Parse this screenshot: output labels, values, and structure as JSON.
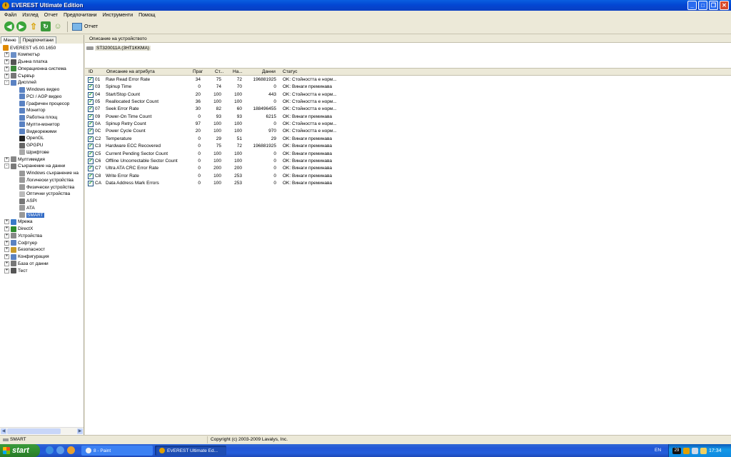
{
  "window": {
    "title": "EVEREST Ultimate Edition"
  },
  "menu": [
    "Файл",
    "Изглед",
    "Отчет",
    "Предпочитани",
    "Инструменти",
    "Помощ"
  ],
  "toolbar": {
    "report_label": "Отчет"
  },
  "left_tabs": [
    "Меню",
    "Предпочитани"
  ],
  "tree": [
    {
      "label": "EVEREST v5.00.1650",
      "level": 0,
      "expander": "",
      "icon": "everest-icon",
      "color": "#e08a00"
    },
    {
      "label": "Компютър",
      "level": 1,
      "expander": "+",
      "icon": "computer-icon",
      "color": "#6b8fc7"
    },
    {
      "label": "Дънна платка",
      "level": 1,
      "expander": "+",
      "icon": "motherboard-icon",
      "color": "#555555"
    },
    {
      "label": "Операционна система",
      "level": 1,
      "expander": "+",
      "icon": "os-icon",
      "color": "#3b8a3b"
    },
    {
      "label": "Сървър",
      "level": 1,
      "expander": "+",
      "icon": "server-icon",
      "color": "#777777"
    },
    {
      "label": "Дисплей",
      "level": 1,
      "expander": "-",
      "icon": "display-icon",
      "color": "#5a82c2"
    },
    {
      "label": "Windows видео",
      "level": 2,
      "expander": "",
      "icon": "monitor-icon",
      "color": "#5a82c2"
    },
    {
      "label": "PCI / AGP видео",
      "level": 2,
      "expander": "",
      "icon": "monitor-icon",
      "color": "#5a82c2"
    },
    {
      "label": "Графичен процесор",
      "level": 2,
      "expander": "",
      "icon": "monitor-icon",
      "color": "#5a82c2"
    },
    {
      "label": "Монитор",
      "level": 2,
      "expander": "",
      "icon": "monitor-icon",
      "color": "#5a82c2"
    },
    {
      "label": "Работна площ",
      "level": 2,
      "expander": "",
      "icon": "desktop-icon",
      "color": "#5a82c2"
    },
    {
      "label": "Мулти-монитор",
      "level": 2,
      "expander": "",
      "icon": "monitor-icon",
      "color": "#5a82c2"
    },
    {
      "label": "Видеорежими",
      "level": 2,
      "expander": "",
      "icon": "monitor-icon",
      "color": "#5a82c2"
    },
    {
      "label": "OpenGL",
      "level": 2,
      "expander": "",
      "icon": "opengl-icon",
      "color": "#222222"
    },
    {
      "label": "GPGPU",
      "level": 2,
      "expander": "",
      "icon": "gpu-icon",
      "color": "#666666"
    },
    {
      "label": "Шрифтове",
      "level": 2,
      "expander": "",
      "icon": "font-icon",
      "color": "#aaaaaa"
    },
    {
      "label": "Мултимедия",
      "level": 1,
      "expander": "+",
      "icon": "multimedia-icon",
      "color": "#888888"
    },
    {
      "label": "Съхранение на данни",
      "level": 1,
      "expander": "-",
      "icon": "storage-icon",
      "color": "#7a7a7a"
    },
    {
      "label": "Windows съхранение на",
      "level": 2,
      "expander": "",
      "icon": "drive-icon",
      "color": "#999999"
    },
    {
      "label": "Логически устройства",
      "level": 2,
      "expander": "",
      "icon": "drive-icon",
      "color": "#999999"
    },
    {
      "label": "Физически устройства",
      "level": 2,
      "expander": "",
      "icon": "drive-icon",
      "color": "#999999"
    },
    {
      "label": "Оптични устройства",
      "level": 2,
      "expander": "",
      "icon": "optical-icon",
      "color": "#bbbbbb"
    },
    {
      "label": "ASPI",
      "level": 2,
      "expander": "",
      "icon": "aspi-icon",
      "color": "#777777"
    },
    {
      "label": "ATA",
      "level": 2,
      "expander": "",
      "icon": "drive-icon",
      "color": "#999999"
    },
    {
      "label": "SMART",
      "level": 2,
      "expander": "",
      "icon": "drive-icon",
      "color": "#999999",
      "selected": true
    },
    {
      "label": "Мрежа",
      "level": 1,
      "expander": "+",
      "icon": "network-icon",
      "color": "#3a7ac8"
    },
    {
      "label": "DirectX",
      "level": 1,
      "expander": "+",
      "icon": "directx-icon",
      "color": "#2e8b2e"
    },
    {
      "label": "Устройства",
      "level": 1,
      "expander": "+",
      "icon": "devices-icon",
      "color": "#888888"
    },
    {
      "label": "Софтуер",
      "level": 1,
      "expander": "+",
      "icon": "software-icon",
      "color": "#5a82c2"
    },
    {
      "label": "Безопасност",
      "level": 1,
      "expander": "+",
      "icon": "security-icon",
      "color": "#c79a2a"
    },
    {
      "label": "Конфигурация",
      "level": 1,
      "expander": "+",
      "icon": "config-icon",
      "color": "#5a82c2"
    },
    {
      "label": "База от данни",
      "level": 1,
      "expander": "+",
      "icon": "database-icon",
      "color": "#777777"
    },
    {
      "label": "Тест",
      "level": 1,
      "expander": "+",
      "icon": "test-icon",
      "color": "#555555"
    }
  ],
  "device": {
    "header": "Описание на устройството",
    "name": "ST320011A (3HT1KKMA)"
  },
  "smart": {
    "columns": [
      "ID",
      "Описание на атрибута",
      "Праг",
      "Ст...",
      "На...",
      "Данни",
      "Статус"
    ],
    "rows": [
      [
        "01",
        "Raw Read Error Rate",
        "34",
        "75",
        "72",
        "196881925",
        "OK: Стойността е норм..."
      ],
      [
        "03",
        "Spinup Time",
        "0",
        "74",
        "70",
        "0",
        "OK: Винаги преминава"
      ],
      [
        "04",
        "Start/Stop Count",
        "20",
        "100",
        "100",
        "443",
        "OK: Стойността е норм..."
      ],
      [
        "05",
        "Reallocated Sector Count",
        "36",
        "100",
        "100",
        "0",
        "OK: Стойността е норм..."
      ],
      [
        "07",
        "Seek Error Rate",
        "30",
        "82",
        "60",
        "188496455",
        "OK: Стойността е норм..."
      ],
      [
        "09",
        "Power-On Time Count",
        "0",
        "93",
        "93",
        "6215",
        "OK: Винаги преминава"
      ],
      [
        "0A",
        "Spinup Retry Count",
        "97",
        "100",
        "100",
        "0",
        "OK: Стойността е норм..."
      ],
      [
        "0C",
        "Power Cycle Count",
        "20",
        "100",
        "100",
        "970",
        "OK: Стойността е норм..."
      ],
      [
        "C2",
        "Temperature",
        "0",
        "29",
        "51",
        "29",
        "OK: Винаги преминава"
      ],
      [
        "C3",
        "Hardware ECC Recovered",
        "0",
        "75",
        "72",
        "196881925",
        "OK: Винаги преминава"
      ],
      [
        "C5",
        "Current Pending Sector Count",
        "0",
        "100",
        "100",
        "0",
        "OK: Винаги преминава"
      ],
      [
        "C6",
        "Offline Uncorrectable Sector Count",
        "0",
        "100",
        "100",
        "0",
        "OK: Винаги преминава"
      ],
      [
        "C7",
        "Ultra ATA CRC Error Rate",
        "0",
        "200",
        "200",
        "0",
        "OK: Винаги преминава"
      ],
      [
        "C8",
        "Write Error Rate",
        "0",
        "100",
        "253",
        "0",
        "OK: Винаги преминава"
      ],
      [
        "CA",
        "Data Address Mark Errors",
        "0",
        "100",
        "253",
        "0",
        "OK: Винаги преминава"
      ]
    ]
  },
  "statusbar": {
    "left": "SMART",
    "center": "Copyright (c) 2003-2009 Lavalys, Inc."
  },
  "taskbar": {
    "start": "start",
    "tasks": [
      "8 - Paint",
      "EVEREST Ultimate Ed..."
    ],
    "lang": "EN",
    "tray_badge": "29",
    "clock": "17:34"
  }
}
